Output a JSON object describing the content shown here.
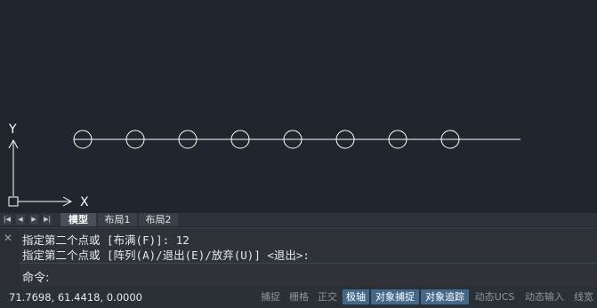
{
  "drawing": {
    "axis_y_label": "Y",
    "axis_x_label": "X",
    "circle_count": 8
  },
  "tabs": {
    "model": "模型",
    "layout1": "布局1",
    "layout2": "布局2"
  },
  "command": {
    "history": [
      "指定第二个点或 [布满(F)]: 12",
      "指定第二个点或 [阵列(A)/退出(E)/放弃(U)] <退出>:"
    ],
    "prompt": "命令:",
    "input_value": ""
  },
  "status": {
    "coordinates": "71.7698, 61.4418, 0.0000",
    "snap": "捕捉",
    "grid": "栅格",
    "ortho": "正交",
    "polar": "极轴",
    "osnap": "对象捕捉",
    "otrack": "对象追踪",
    "ducs": "动态UCS",
    "dyn": "动态输入",
    "lineweight": "线宽"
  },
  "colors": {
    "background": "#21252d",
    "linework": "#ffffff",
    "status_on": "#44688a"
  },
  "icons": [
    "close-icon",
    "first-tab-icon",
    "prev-tab-icon",
    "next-tab-icon",
    "last-tab-icon",
    "ucs-icon"
  ]
}
